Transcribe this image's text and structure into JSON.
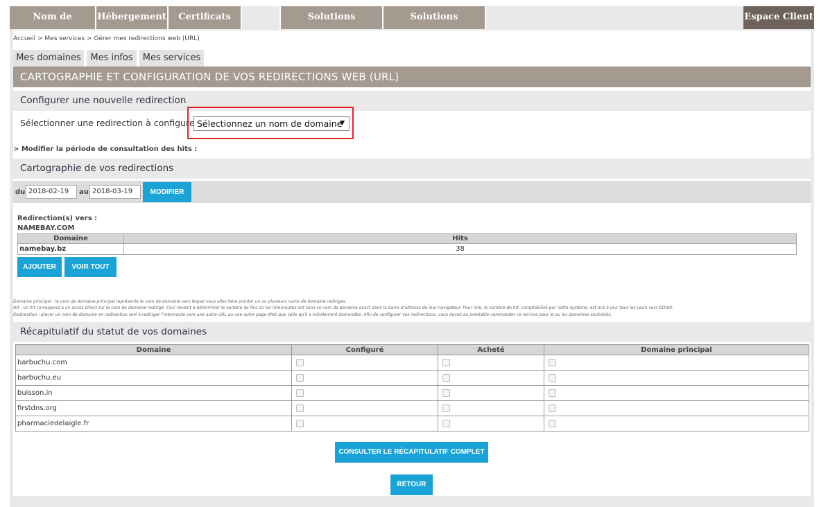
{
  "nav": {
    "items": [
      "Nom de domaine",
      "Hébergement",
      "Certificats SSL",
      "",
      "Solutions Revendeurs",
      "Solutions Entreprises"
    ],
    "client": "Espace Client"
  },
  "breadcrumb": "Accueil > Mes services > Gérer mes redirections web (URL)",
  "tabs": [
    "Mes domaines",
    "Mes infos",
    "Mes services"
  ],
  "banner": "CARTOGRAPHIE ET CONFIGURATION DE VOS REDIRECTIONS WEB (URL)",
  "new_redirect": {
    "title": "Configurer une nouvelle redirection",
    "label": "Sélectionner une redirection à configurer :",
    "select_value": "Sélectionnez un nom de domaine"
  },
  "hits_period_link": "> Modifier la période de consultation des hits :",
  "map": {
    "title": "Cartographie de vos redirections",
    "from_label": "du",
    "from_value": "2018-02-19",
    "to_label": "au",
    "to_value": "2018-03-19",
    "modify_button": "MODIFIER",
    "redirect_to_label": "Redirection(s) vers :",
    "redirect_target": "NAMEBAY.COM",
    "columns": [
      "Domaine",
      "Hits"
    ],
    "rows": [
      {
        "domain": "namebay.bz",
        "hits": "38"
      }
    ],
    "add_button": "AJOUTER",
    "view_all_button": "VOIR TOUT"
  },
  "legend": [
    "Domaine principal : le nom de domaine principal représente le nom de domaine vers lequel vous allez faire pointer un ou plusieurs noms de domaine redirigés.",
    "Hit : un hit correspond à un accès direct sur le nom de domaine redirigé. Ceci revient à déterminer le nombre de fois où les internautes ont saisi ce nom de domaine exact dans la barre d'adresse de leur navigateur. Pour info, le nombre de hit, comptabilisé par notre système, est mis à jour tous les jours vers 01h00.",
    "Redirection : placer un nom de domaine en redirection sert à rediriger l'internaute vers une autre URL ou une autre page Web que celle qu'il a initialement demandée. Afin de configurer vos redirections, vous devez au préalable commander ce service pour le ou les domaines souhaités."
  ],
  "status": {
    "title": "Récapitulatif du statut de vos domaines",
    "columns": [
      "Domaine",
      "Configuré",
      "Acheté",
      "Domaine principal"
    ],
    "rows": [
      "barbuchu.com",
      "barbuchu.eu",
      "buisson.in",
      "firstdns.org",
      "pharmaciedelaigle.fr"
    ],
    "full_summary_button": "CONSULTER LE RÉCAPITULATIF COMPLET",
    "back_button": "RETOUR"
  }
}
